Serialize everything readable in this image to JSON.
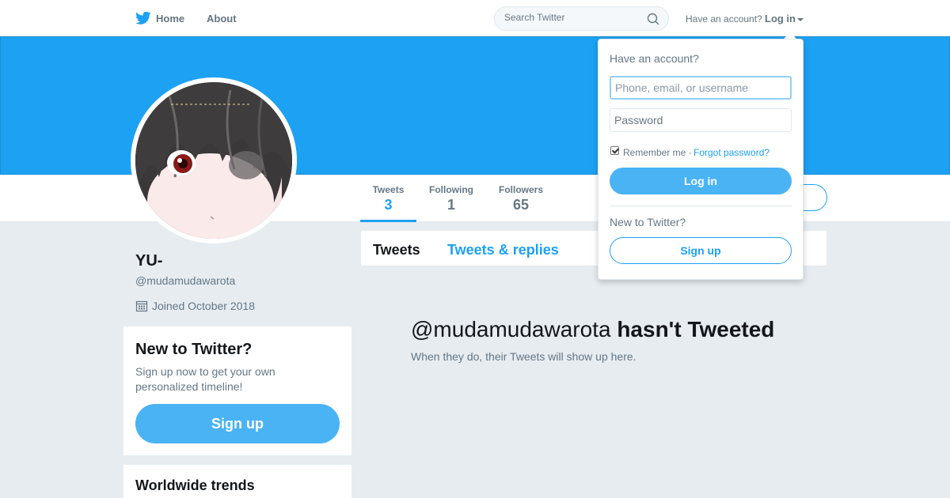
{
  "nav": {
    "home_label": "Home",
    "about_label": "About",
    "search_placeholder": "Search Twitter",
    "have_account_text": "Have an account?",
    "login_label": "Log in"
  },
  "profile": {
    "name": "YU-",
    "handle": "@mudamudawarota",
    "joined": "Joined October 2018"
  },
  "stats": {
    "tweets_label": "Tweets",
    "tweets_value": "3",
    "following_label": "Following",
    "following_value": "1",
    "followers_label": "Followers",
    "followers_value": "65"
  },
  "timeline": {
    "tab_tweets": "Tweets",
    "tab_replies": "Tweets & replies",
    "empty_handle": "@mudamudawarota",
    "empty_title_rest": "hasn't Tweeted",
    "empty_sub": "When they do, their Tweets will show up here."
  },
  "signup_module": {
    "title": "New to Twitter?",
    "description": "Sign up now to get your own personalized timeline!",
    "button_label": "Sign up"
  },
  "trends": {
    "title": "Worldwide trends"
  },
  "login_dropdown": {
    "title": "Have an account?",
    "username_placeholder": "Phone, email, or username",
    "password_placeholder": "Password",
    "remember_label": "Remember me ·",
    "remember_checked": true,
    "forgot_label": "Forgot password?",
    "login_button": "Log in",
    "new_text": "New to Twitter?",
    "signup_button": "Sign up"
  },
  "colors": {
    "brand": "#1da1f2",
    "button": "#4ab3f4",
    "background": "#e6ecf0"
  }
}
